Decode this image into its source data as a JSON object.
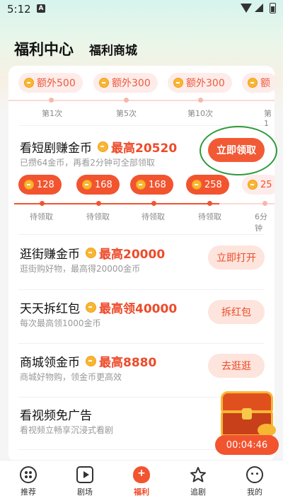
{
  "status_bar": {
    "time": "5:12",
    "notification_icon": "A"
  },
  "header": {
    "title": "福利中心",
    "tab": "福利商城"
  },
  "milestones": {
    "pills": [
      "额外500",
      "额外300",
      "额外300",
      "额"
    ],
    "labels": [
      "第1次",
      "第5次",
      "第10次",
      "第1"
    ]
  },
  "drama_task": {
    "title": "看短剧赚金币",
    "reward": "最高20520",
    "subtitle": "已攒64金币，再看2分钟可全部领取",
    "button": "立即领取"
  },
  "drama_progress": {
    "pills": [
      "128",
      "168",
      "168",
      "258",
      "25"
    ],
    "labels": [
      "待领取",
      "待领取",
      "待领取",
      "待领取",
      "6分钟"
    ]
  },
  "tasks": [
    {
      "title": "逛街赚金币",
      "reward": "最高20000",
      "subtitle": "逛街购好物，最高得20000金币",
      "button": "立即打开"
    },
    {
      "title": "天天拆红包",
      "reward": "最高领40000",
      "subtitle": "每次最高领1000金币",
      "button": "拆红包"
    },
    {
      "title": "商城领金币",
      "reward": "最高8880",
      "subtitle": "商城好物购，领金币更高效",
      "button": "去逛逛"
    },
    {
      "title": "看视频免广告",
      "reward": "",
      "subtitle": "看视频立畅享沉浸式看剧",
      "button": ""
    }
  ],
  "chest": {
    "timer": "00:04:46"
  },
  "bottom_nav": [
    {
      "label": "推荐",
      "icon": "recommend-icon"
    },
    {
      "label": "剧场",
      "icon": "theater-play-icon"
    },
    {
      "label": "福利",
      "icon": "welfare-bag-icon"
    },
    {
      "label": "追剧",
      "icon": "follow-star-icon"
    },
    {
      "label": "我的",
      "icon": "profile-face-icon"
    }
  ],
  "colors": {
    "accent": "#f2542f",
    "annotation": "#2e9a3a"
  }
}
